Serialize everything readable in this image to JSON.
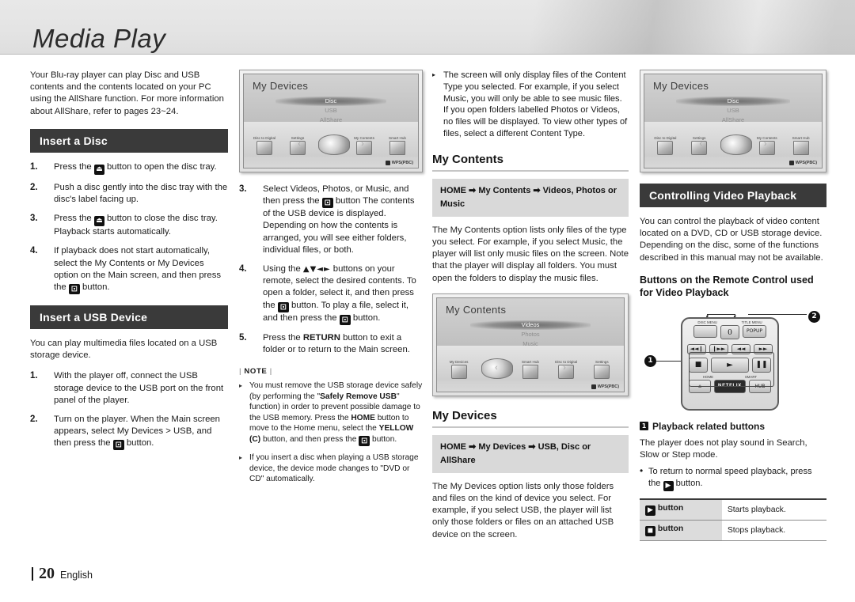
{
  "page": {
    "title": "Media Play",
    "footer_page_number": "20",
    "footer_language": "English",
    "accent_dark": "#3a3a3a",
    "path_box_bg": "#d9d9d9"
  },
  "col1": {
    "intro": "Your Blu-ray player can play Disc and USB contents and the contents located on your PC using the AllShare function. For more information about AllShare, refer to pages 23~24.",
    "disc_heading": "Insert a Disc",
    "disc_steps": [
      {
        "num": "1.",
        "pre": "Press the",
        "icon": "eject-button-icon",
        "post": "button to open the disc tray."
      },
      {
        "num": "2.",
        "pre": "Push a disc gently into the disc tray with the disc's label facing up.",
        "icon": "",
        "post": ""
      },
      {
        "num": "3.",
        "pre": "Press the",
        "icon": "eject-button-icon",
        "post": "button to close the disc tray. Playback starts automatically."
      },
      {
        "num": "4.",
        "pre": "If playback does not start automatically, select the My Contents or My Devices option on the Main screen, and then press the",
        "icon": "enter-button-icon",
        "post": "button."
      }
    ],
    "usb_heading": "Insert a USB Device",
    "usb_intro": "You can play multimedia files located on a USB storage device.",
    "usb_steps": [
      {
        "num": "1.",
        "pre": "With the player off, connect the USB storage device to the USB port on the front panel of the player.",
        "icon": "",
        "post": ""
      },
      {
        "num": "2.",
        "pre": "Turn on the player. When the Main screen appears, select My Devices > USB, and then press the",
        "icon": "enter-button-icon",
        "post": "button."
      }
    ]
  },
  "col2": {
    "screen": {
      "title": "My Devices",
      "options": [
        "Disc",
        "USB",
        "AllShare"
      ],
      "selected_option": "Disc",
      "icons": [
        "Disc to Digital",
        "Settings",
        "",
        "My Contents",
        "Smart Hub"
      ],
      "wps_label": "WPS(PBC)"
    },
    "steps": [
      {
        "num": "3.",
        "pre": "Select Videos, Photos, or Music, and then press the",
        "icon": "enter-button-icon",
        "post": "button The contents of the USB device is displayed. Depending on how the contents is arranged, you will see either folders, individual files, or both."
      },
      {
        "num": "4.",
        "pre": "Using the",
        "icon": "dpad-arrows-icon",
        "post": "buttons on your remote, select the desired contents. To open a folder, select it, and then press the",
        "icon2": "enter-button-icon",
        "post2": "button. To play a file, select it, and then press the",
        "icon3": "enter-button-icon",
        "post3": "button."
      },
      {
        "num": "5.",
        "pre": "Press the RETURN button to exit a folder or to return to the Main screen.",
        "icon": "",
        "post": ""
      }
    ],
    "note_title": "NOTE",
    "notes": [
      {
        "p1": "You must remove the USB storage device safely (by performing the \"",
        "b1": "Safely Remove USB",
        "p2": "\" function) in order to prevent possible damage to the USB memory. Press the ",
        "b2": "HOME",
        "p3": " button to move to the Home menu, select the ",
        "b3": "YELLOW (C)",
        "p4": " button, and then press the",
        "icon": "enter-button-icon",
        "p5": "button."
      },
      {
        "p1": "If you insert a disc when playing a USB storage device, the device mode changes to \"DVD or CD\" automatically."
      }
    ]
  },
  "col3": {
    "top_bullet": "The screen will only display files of the Content Type you selected. For example, if you select Music, you will only be able to see music files. If you open folders labelled Photos or Videos, no files will be displayed. To view other types of files, select a different Content Type.",
    "my_contents_heading": "My Contents",
    "my_contents_path": "HOME ➡ My Contents ➡ Videos, Photos or Music",
    "my_contents_body": "The My Contents option lists only files of the type you select. For example, if you select Music, the player will list only music files on the screen. Note that the player will display all folders. You must open the folders to display the music files.",
    "screen": {
      "title": "My Contents",
      "options": [
        "Videos",
        "Photos",
        "Music"
      ],
      "selected_option": "Videos",
      "icons": [
        "My Devices",
        "",
        "Smart Hub",
        "Disc to Digital",
        "Settings"
      ],
      "wps_label": "WPS(PBC)"
    },
    "my_devices_heading": "My Devices",
    "my_devices_path": "HOME ➡ My Devices ➡ USB, Disc or AllShare",
    "my_devices_body": "The My Devices option lists only those folders and files on the kind of device you select. For example, if you select USB, the player will list only those folders or files on an attached USB device on the screen."
  },
  "col4": {
    "screen": {
      "title": "My Devices",
      "options": [
        "Disc",
        "USB",
        "AllShare"
      ],
      "selected_option": "Disc",
      "icons": [
        "Disc to Digital",
        "Settings",
        "",
        "My Contents",
        "Smart Hub"
      ],
      "wps_label": "WPS(PBC)"
    },
    "heading": "Controlling Video Playback",
    "intro": "You can control the playback of video content located on a DVD, CD or USB storage device. Depending on the disc, some of the functions described in this manual may not be available.",
    "sub_heading": "Buttons on the Remote Control used for Video Playback",
    "remote": {
      "label_disc_menu": "DISC MENU",
      "label_title_menu": "TITLE MENU",
      "key_zero": "0",
      "key_popup": "POPUP",
      "key_prev": "◄◄❙",
      "key_next": "❙►►",
      "key_rew": "◄◄",
      "key_ff": "►►",
      "key_stop": "■",
      "key_play": "►",
      "key_pause": "❚❚",
      "label_home": "HOME",
      "key_home": "⌂",
      "key_netflix": "NETFLIX",
      "label_smart_hub": "SMART",
      "key_hub": "HUB",
      "callout_1": "1",
      "callout_2": "2"
    },
    "table_title_num": "1",
    "table_title": "Playback related buttons",
    "table_intro": "The player does not play sound in Search, Slow or Step mode.",
    "table_bullet_pre": "To return to normal speed playback, press the",
    "table_bullet_icon": "play-button-icon",
    "table_bullet_post": "button.",
    "table_rows": [
      {
        "key_icon": "play-button-icon",
        "key_label": "button",
        "value": "Starts playback."
      },
      {
        "key_icon": "stop-button-icon",
        "key_label": "button",
        "value": "Stops playback."
      }
    ]
  }
}
